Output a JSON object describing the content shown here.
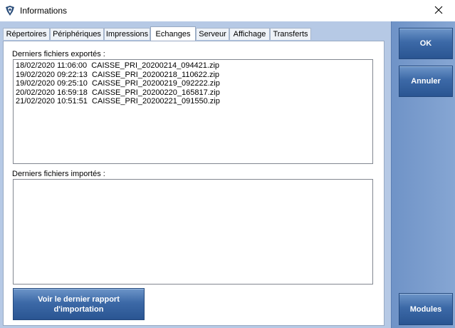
{
  "window": {
    "title": "Informations",
    "icon": "app-logo-icon",
    "close_icon": "close-icon"
  },
  "tabs": [
    {
      "label": "Répertoires",
      "active": false
    },
    {
      "label": "Périphériques",
      "active": false
    },
    {
      "label": "Impressions",
      "active": false
    },
    {
      "label": "Echanges",
      "active": true
    },
    {
      "label": "Serveur",
      "active": false
    },
    {
      "label": "Affichage",
      "active": false
    },
    {
      "label": "Transferts",
      "active": false
    }
  ],
  "exports": {
    "label": "Derniers fichiers exportés :",
    "items": [
      "18/02/2020 11:06:00  CAISSE_PRI_20200214_094421.zip",
      "19/02/2020 09:22:13  CAISSE_PRI_20200218_110622.zip",
      "19/02/2020 09:25:10  CAISSE_PRI_20200219_092222.zip",
      "20/02/2020 16:59:18  CAISSE_PRI_20200220_165817.zip",
      "21/02/2020 10:51:51  CAISSE_PRI_20200221_091550.zip"
    ]
  },
  "imports": {
    "label": "Derniers fichiers importés :",
    "items": []
  },
  "report_button": {
    "line1": "Voir le dernier rapport",
    "line2": "d'importation"
  },
  "sidebar": {
    "ok_label": "OK",
    "cancel_label": "Annuler",
    "modules_label": "Modules"
  },
  "colors": {
    "client_bg": "#b6c9e5",
    "button_blue": "#3c69a7",
    "sidebar_blue": "#7a9dcd"
  }
}
